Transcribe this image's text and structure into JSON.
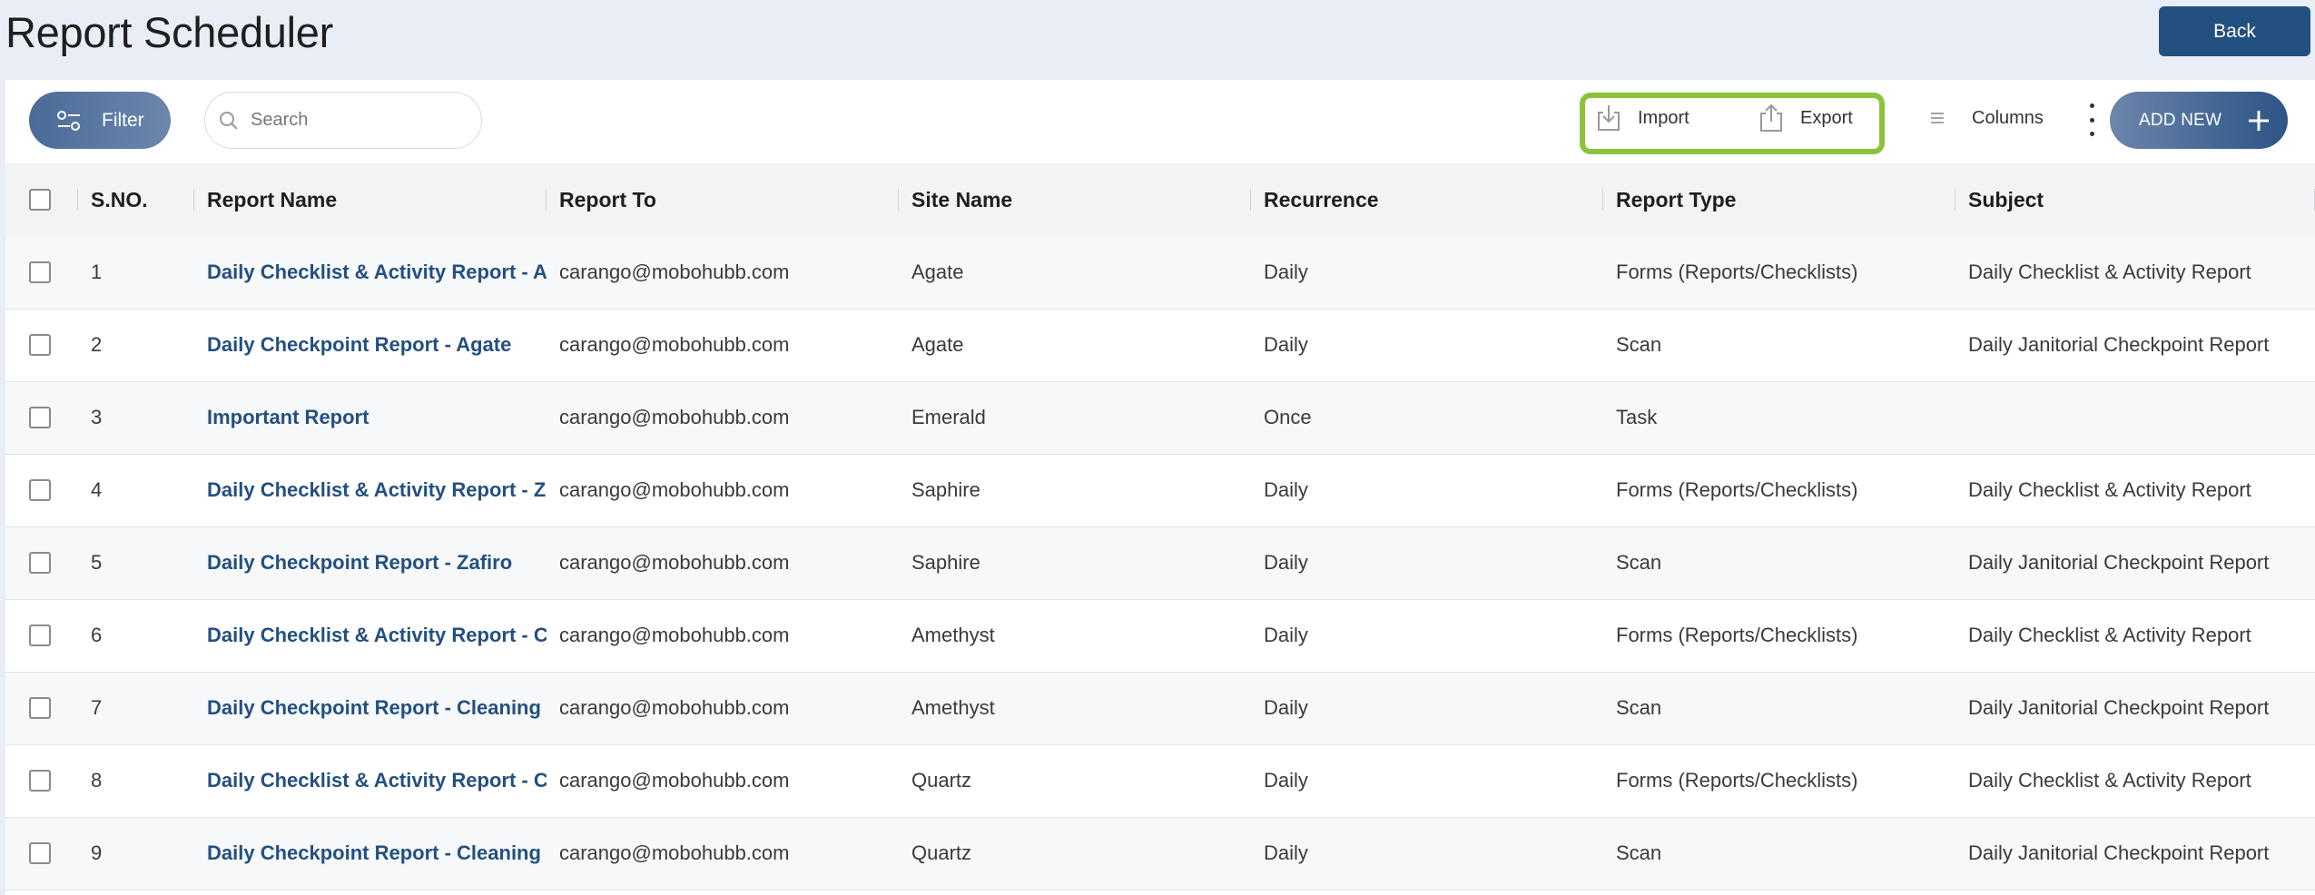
{
  "page_title": "Report Scheduler",
  "back_label": "Back",
  "toolbar": {
    "filter_label": "Filter",
    "search_placeholder": "Search",
    "import_label": "Import",
    "export_label": "Export",
    "columns_label": "Columns",
    "add_new_label": "ADD NEW"
  },
  "colors": {
    "primary": "#24507f",
    "highlight": "#8bc33a"
  },
  "table": {
    "headers": [
      "S.NO.",
      "Report Name",
      "Report To",
      "Site Name",
      "Recurrence",
      "Report Type",
      "Subject"
    ],
    "rows": [
      {
        "sno": "1",
        "name": "Daily Checklist & Activity Report - Agate",
        "to": "carango@mobohubb.com",
        "site": "Agate",
        "recurrence": "Daily",
        "type": "Forms (Reports/Checklists)",
        "subject": "Daily Checklist & Activity Report"
      },
      {
        "sno": "2",
        "name": "Daily Checkpoint Report - Agate",
        "to": "carango@mobohubb.com",
        "site": "Agate",
        "recurrence": "Daily",
        "type": "Scan",
        "subject": "Daily Janitorial Checkpoint Report"
      },
      {
        "sno": "3",
        "name": "Important Report",
        "to": "carango@mobohubb.com",
        "site": "Emerald",
        "recurrence": "Once",
        "type": "Task",
        "subject": ""
      },
      {
        "sno": "4",
        "name": "Daily Checklist & Activity Report - Zafiro",
        "to": "carango@mobohubb.com",
        "site": "Saphire",
        "recurrence": "Daily",
        "type": "Forms (Reports/Checklists)",
        "subject": "Daily Checklist & Activity Report"
      },
      {
        "sno": "5",
        "name": "Daily Checkpoint Report - Zafiro",
        "to": "carango@mobohubb.com",
        "site": "Saphire",
        "recurrence": "Daily",
        "type": "Scan",
        "subject": "Daily Janitorial Checkpoint Report"
      },
      {
        "sno": "6",
        "name": "Daily Checklist & Activity Report - Cleaning",
        "to": "carango@mobohubb.com",
        "site": "Amethyst",
        "recurrence": "Daily",
        "type": "Forms (Reports/Checklists)",
        "subject": "Daily Checklist & Activity Report"
      },
      {
        "sno": "7",
        "name": "Daily Checkpoint Report - Cleaning",
        "to": "carango@mobohubb.com",
        "site": "Amethyst",
        "recurrence": "Daily",
        "type": "Scan",
        "subject": "Daily Janitorial Checkpoint Report"
      },
      {
        "sno": "8",
        "name": "Daily Checklist & Activity Report - Cleaning",
        "to": "carango@mobohubb.com",
        "site": "Quartz",
        "recurrence": "Daily",
        "type": "Forms (Reports/Checklists)",
        "subject": "Daily Checklist & Activity Report"
      },
      {
        "sno": "9",
        "name": "Daily Checkpoint Report - Cleaning",
        "to": "carango@mobohubb.com",
        "site": "Quartz",
        "recurrence": "Daily",
        "type": "Scan",
        "subject": "Daily Janitorial Checkpoint Report"
      }
    ]
  }
}
